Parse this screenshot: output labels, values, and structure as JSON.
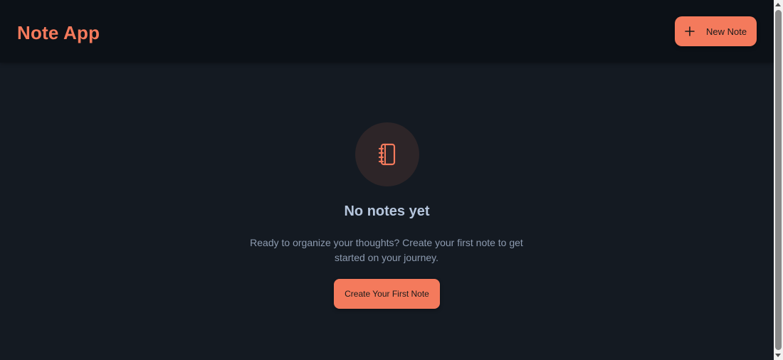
{
  "header": {
    "app_title": "Note App",
    "new_note_label": "New Note",
    "new_note_icon": "plus-icon"
  },
  "empty_state": {
    "icon": "notebook-icon",
    "title": "No notes yet",
    "description": "Ready to organize your thoughts? Create your first note to get started on your journey.",
    "cta_label": "Create Your First Note"
  },
  "colors": {
    "accent": "#f47a5c",
    "header_bg": "#0c1117",
    "page_bg": "#141a22",
    "title_text": "#b6c6dd",
    "body_text": "#8d9bb0",
    "icon_circle_bg": "#2d2528"
  }
}
